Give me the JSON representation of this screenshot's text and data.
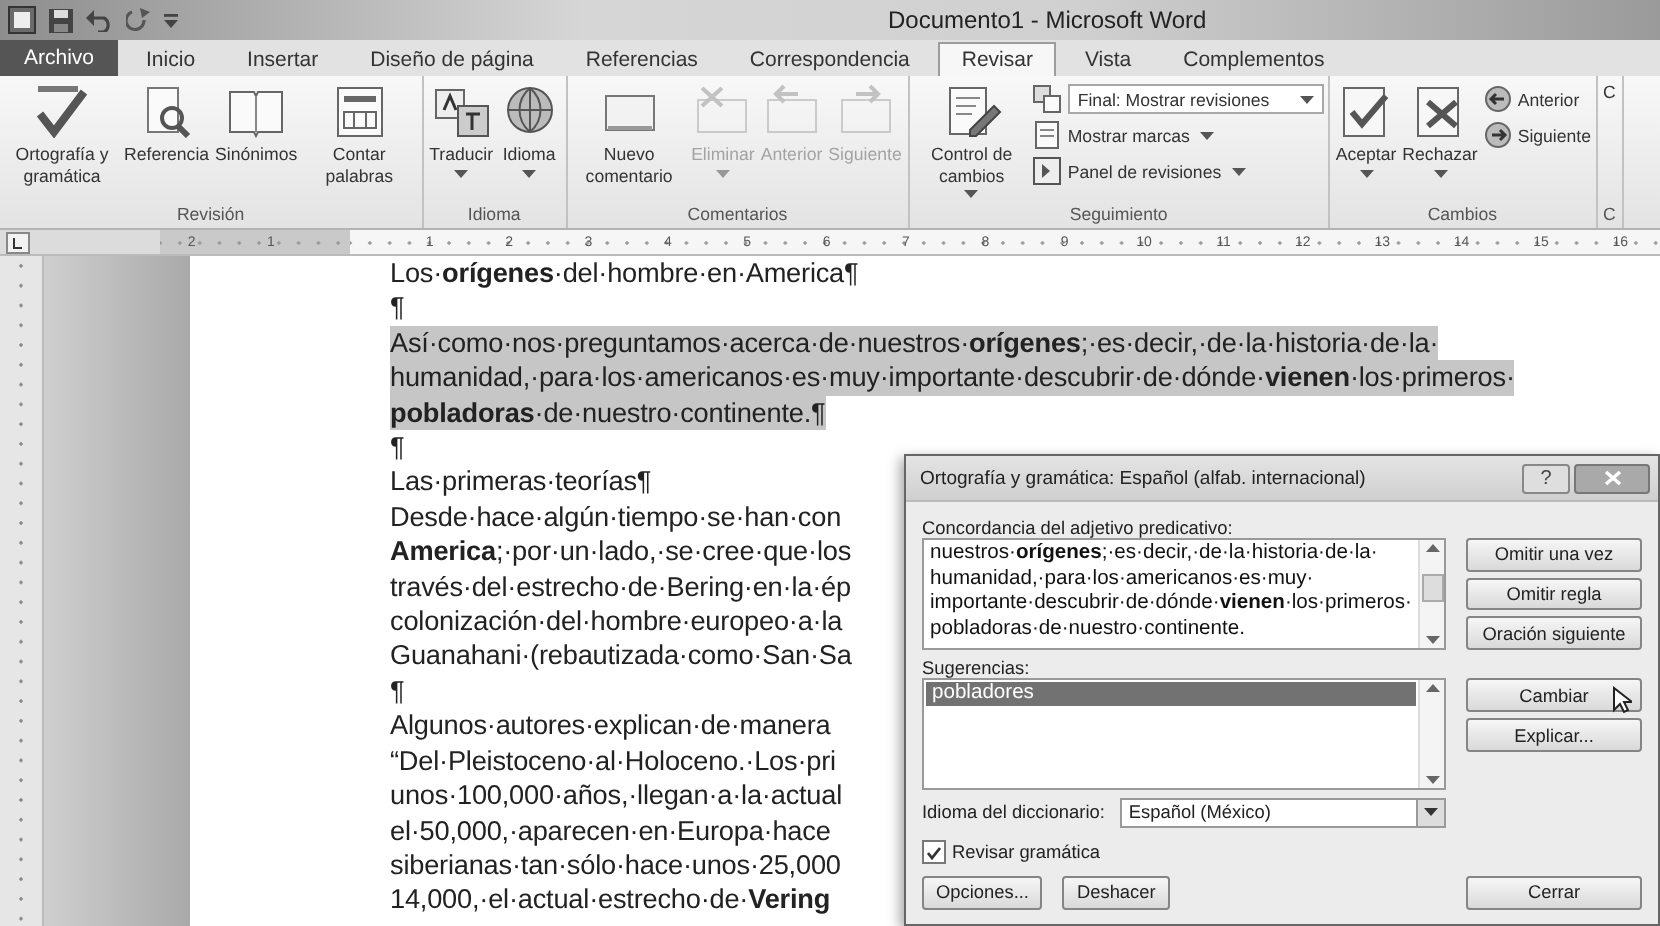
{
  "title_bar": {
    "title": "Documento1 - Microsoft Word"
  },
  "tabs": [
    {
      "label": "Archivo",
      "kind": "file",
      "selected": false
    },
    {
      "label": "Inicio",
      "kind": "tab",
      "selected": false
    },
    {
      "label": "Insertar",
      "kind": "tab",
      "selected": false
    },
    {
      "label": "Diseño de página",
      "kind": "tab",
      "selected": false
    },
    {
      "label": "Referencias",
      "kind": "tab",
      "selected": false
    },
    {
      "label": "Correspondencia",
      "kind": "tab",
      "selected": false
    },
    {
      "label": "Revisar",
      "kind": "tab",
      "selected": true
    },
    {
      "label": "Vista",
      "kind": "tab",
      "selected": false
    },
    {
      "label": "Complementos",
      "kind": "tab",
      "selected": false
    }
  ],
  "ribbon": {
    "groups": [
      {
        "label": "Revisión",
        "buttons": [
          {
            "label": "Ortografía y gramática",
            "menu": false,
            "disabled": false
          },
          {
            "label": "Referencia",
            "menu": false,
            "disabled": false
          },
          {
            "label": "Sinónimos",
            "menu": false,
            "disabled": false
          },
          {
            "label": "Contar palabras",
            "menu": false,
            "disabled": false
          }
        ]
      },
      {
        "label": "Idioma",
        "buttons": [
          {
            "label": "Traducir",
            "menu": true,
            "disabled": false
          },
          {
            "label": "Idioma",
            "menu": true,
            "disabled": false
          }
        ]
      },
      {
        "label": "Comentarios",
        "buttons": [
          {
            "label": "Nuevo comentario",
            "menu": false,
            "disabled": false
          },
          {
            "label": "Eliminar",
            "menu": true,
            "disabled": true
          },
          {
            "label": "Anterior",
            "menu": false,
            "disabled": true
          },
          {
            "label": "Siguiente",
            "menu": false,
            "disabled": true
          }
        ]
      },
      {
        "label": "Seguimiento",
        "buttons": [
          {
            "label": "Control de cambios",
            "menu": true,
            "disabled": false
          }
        ],
        "dropdown": {
          "value": "Final: Mostrar revisiones"
        },
        "small_buttons": [
          {
            "label": "Mostrar marcas",
            "menu": true,
            "disabled": false
          },
          {
            "label": "Panel de revisiones",
            "menu": true,
            "disabled": false
          }
        ]
      },
      {
        "label": "Cambios",
        "buttons": [
          {
            "label": "Aceptar",
            "menu": true,
            "disabled": false
          },
          {
            "label": "Rechazar",
            "menu": true,
            "disabled": false
          }
        ],
        "small_buttons": [
          {
            "label": "Anterior",
            "menu": false,
            "disabled": false
          },
          {
            "label": "Siguiente",
            "menu": false,
            "disabled": false
          }
        ]
      },
      {
        "label": "C",
        "buttons": [
          {
            "label": "C",
            "menu": false,
            "disabled": false
          }
        ]
      }
    ]
  },
  "ruler": {
    "left_labels": [
      "2",
      "1"
    ],
    "labels": [
      "1",
      "2",
      "3",
      "4",
      "5",
      "6",
      "7",
      "8",
      "9",
      "10",
      "11",
      "12",
      "13",
      "14",
      "15",
      "16"
    ]
  },
  "document": {
    "lines": [
      {
        "text": "Los·**orígenes**·del·hombre·en·America¶",
        "highlighted": false
      },
      {
        "text": "¶",
        "highlighted": false
      },
      {
        "text": "Así·como·nos·preguntamos·acerca·de·nuestros·**orígenes**;·es·decir,·de·la·historia·de·la·",
        "highlighted": true
      },
      {
        "text": "humanidad,·para·los·americanos·es·muy·importante·descubrir·de·dónde·**vienen**·los·primeros·",
        "highlighted": true
      },
      {
        "text": "**pobladoras**·de·nuestro·continente.¶",
        "highlighted": true
      },
      {
        "text": "¶",
        "highlighted": false
      },
      {
        "text": "Las·primeras·teorías¶",
        "highlighted": false
      },
      {
        "text": "Desde·hace·algún·tiempo·se·han·con",
        "highlighted": false
      },
      {
        "text": "**America**;·por·un·lado,·se·cree·que·los",
        "highlighted": false
      },
      {
        "text": "través·del·estrecho·de·Bering·en·la·ép",
        "highlighted": false
      },
      {
        "text": "colonización·del·hombre·europeo·a·la",
        "highlighted": false
      },
      {
        "text": "Guanahani·(rebautizada·como·San·Sa",
        "highlighted": false
      },
      {
        "text": "¶",
        "highlighted": false
      },
      {
        "text": "Algunos·autores·explican·de·manera",
        "highlighted": false
      },
      {
        "text": "“Del·Pleistoceno·al·Holoceno.·Los·pri",
        "highlighted": false
      },
      {
        "text": "unos·100,000·años,·llegan·a·la·actual",
        "highlighted": false
      },
      {
        "text": "el·50,000,·aparecen·en·Europa·hace",
        "highlighted": false
      },
      {
        "text": "siberianas·tan·sólo·hace·unos·25,000",
        "highlighted": false
      },
      {
        "text": "14,000,·el·actual·estrecho·de·**Vering**",
        "highlighted": false
      }
    ]
  },
  "dialog": {
    "title": "Ortografía y gramática: Español (alfab. internacional)",
    "help": "?",
    "issue_label": "Concordancia del adjetivo predicativo:",
    "sentence": "nuestros·**orígenes**;·es·decir,·de·la·historia·de·la·humanidad,·para·los·americanos·es·muy·importante·descubrir·de·dónde·**vienen**·los·primeros·pobladoras·de·nuestro·continente.",
    "suggestions_label": "Sugerencias:",
    "suggestions": [
      {
        "text": "pobladores",
        "selected": true
      }
    ],
    "language_label": "Idioma del diccionario:",
    "language": "Español (México)",
    "grammar_check": {
      "label": "Revisar gramática",
      "checked": true
    },
    "rule_buttons": [
      "Omitir una vez",
      "Omitir regla",
      "Oración siguiente"
    ],
    "change_buttons": [
      "Cambiar",
      "Explicar..."
    ],
    "bottom_buttons": [
      "Opciones...",
      "Deshacer"
    ],
    "close_button": "Cerrar"
  }
}
